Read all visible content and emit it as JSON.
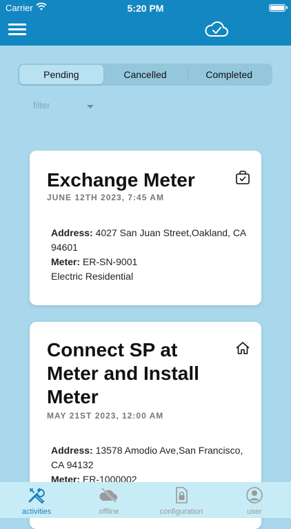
{
  "status_bar": {
    "carrier": "Carrier",
    "time": "5:20 PM"
  },
  "nav": {
    "menu_icon": "hamburger-menu-icon",
    "sync_icon": "cloud-check-icon"
  },
  "segments": [
    {
      "label": "Pending",
      "active": true
    },
    {
      "label": "Cancelled",
      "active": false
    },
    {
      "label": "Completed",
      "active": false
    }
  ],
  "filter": {
    "label": "filter"
  },
  "cards": [
    {
      "title": "Exchange Meter",
      "date": "JUNE 12TH 2023, 7:45 AM",
      "icon": "briefcase-check-icon",
      "address_label": "Address:",
      "address": "4027 San Juan Street,Oakland, CA 94601",
      "meter_label": "Meter:",
      "meter": "ER-SN-9001",
      "meter_type": "Electric Residential"
    },
    {
      "title": "Connect SP at Meter and Install Meter",
      "date": "MAY 21ST 2023, 12:00 AM",
      "icon": "house-icon",
      "address_label": "Address:",
      "address": "13578 Amodio Ave,San Francisco, CA 94132",
      "meter_label": "Meter:",
      "meter": "ER-1000002"
    }
  ],
  "tabs": [
    {
      "label": "activities",
      "icon": "tools-icon",
      "active": true
    },
    {
      "label": "offline",
      "icon": "cloud-off-icon",
      "active": false
    },
    {
      "label": "configuration",
      "icon": "lock-document-icon",
      "active": false
    },
    {
      "label": "user",
      "icon": "user-circle-icon",
      "active": false
    }
  ],
  "colors": {
    "header": "#1387c1",
    "background": "#a9d8ec",
    "tab_active": "#1d7fc0"
  }
}
